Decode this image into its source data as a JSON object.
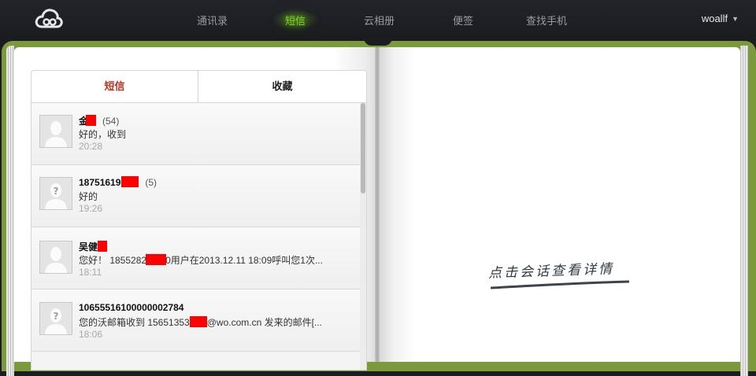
{
  "nav": {
    "items": [
      "通讯录",
      "短信",
      "云相册",
      "便签",
      "查找手机"
    ],
    "active": "短信",
    "user": "woallf",
    "accent": "#7ed321"
  },
  "tabs": {
    "sms": "短信",
    "favorites": "收藏",
    "active_color": "#b8331f"
  },
  "messages": [
    {
      "name": "金",
      "count": "(54)",
      "preview": "好的，收到",
      "time": "20:28",
      "avatar": "person-icon"
    },
    {
      "name": "18751619",
      "count": "(5)",
      "preview": "好的",
      "time": "19:26",
      "avatar": "unknown-contact-icon"
    },
    {
      "name": "吴健",
      "count": "",
      "preview_before": "您好！ 1855282",
      "preview_after": "0用户在2013.12.11 18:09呼叫您1次...",
      "time": "18:11",
      "avatar": "person-icon"
    },
    {
      "name": "10655516100000002784",
      "count": "",
      "preview_before": "您的沃邮箱收到 15651353",
      "preview_after": "@wo.com.cn 发来的邮件[...",
      "time": "18:06",
      "avatar": "unknown-contact-icon"
    }
  ],
  "hint": "点击会话查看详情"
}
